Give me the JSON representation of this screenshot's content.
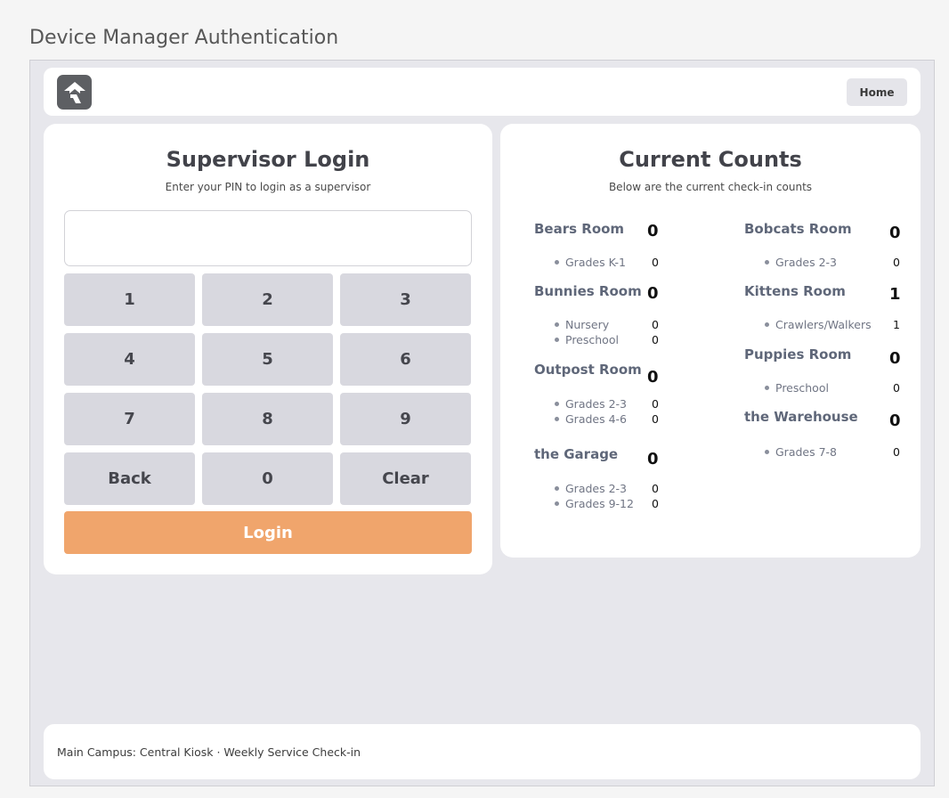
{
  "page": {
    "heading": "Device Manager Authentication"
  },
  "topbar": {
    "home_label": "Home",
    "logo_icon": "rock-logo-icon"
  },
  "login": {
    "title": "Supervisor Login",
    "subtitle": "Enter your PIN to login as a supervisor",
    "pin_value": "",
    "keys": [
      "1",
      "2",
      "3",
      "4",
      "5",
      "6",
      "7",
      "8",
      "9",
      "Back",
      "0",
      "Clear"
    ],
    "login_label": "Login"
  },
  "counts": {
    "title": "Current Counts",
    "subtitle": "Below are the current check-in counts",
    "left_rooms": [
      {
        "name": "Bears Room",
        "count": "0",
        "groups": [
          {
            "name": "Grades K-1",
            "count": "0"
          }
        ]
      },
      {
        "name": "Bunnies Room",
        "count": "0",
        "groups": [
          {
            "name": "Nursery",
            "count": "0"
          },
          {
            "name": "Preschool",
            "count": "0"
          }
        ]
      },
      {
        "name": "Outpost Room",
        "count": "0",
        "groups": [
          {
            "name": "Grades 2-3",
            "count": "0"
          },
          {
            "name": "Grades 4-6",
            "count": "0"
          }
        ]
      },
      {
        "name": "the Garage",
        "count": "0",
        "groups": [
          {
            "name": "Grades 2-3",
            "count": "0"
          },
          {
            "name": "Grades 9-12",
            "count": "0"
          }
        ]
      }
    ],
    "right_rooms": [
      {
        "name": "Bobcats Room",
        "count": "0",
        "groups": [
          {
            "name": "Grades 2-3",
            "count": "0"
          }
        ]
      },
      {
        "name": "Kittens Room",
        "count": "1",
        "groups": [
          {
            "name": "Crawlers/Walkers",
            "count": "1"
          }
        ]
      },
      {
        "name": "Puppies Room",
        "count": "0",
        "groups": [
          {
            "name": "Preschool",
            "count": "0"
          }
        ]
      },
      {
        "name": "the Warehouse",
        "count": "0",
        "groups": [
          {
            "name": "Grades 7-8",
            "count": "0"
          }
        ]
      }
    ]
  },
  "footer": {
    "text": "Main Campus: Central Kiosk · Weekly Service Check-in"
  },
  "colors": {
    "accent": "#f0a56c",
    "key_bg": "#d8d8df",
    "frame_bg": "#e7e7ec"
  }
}
